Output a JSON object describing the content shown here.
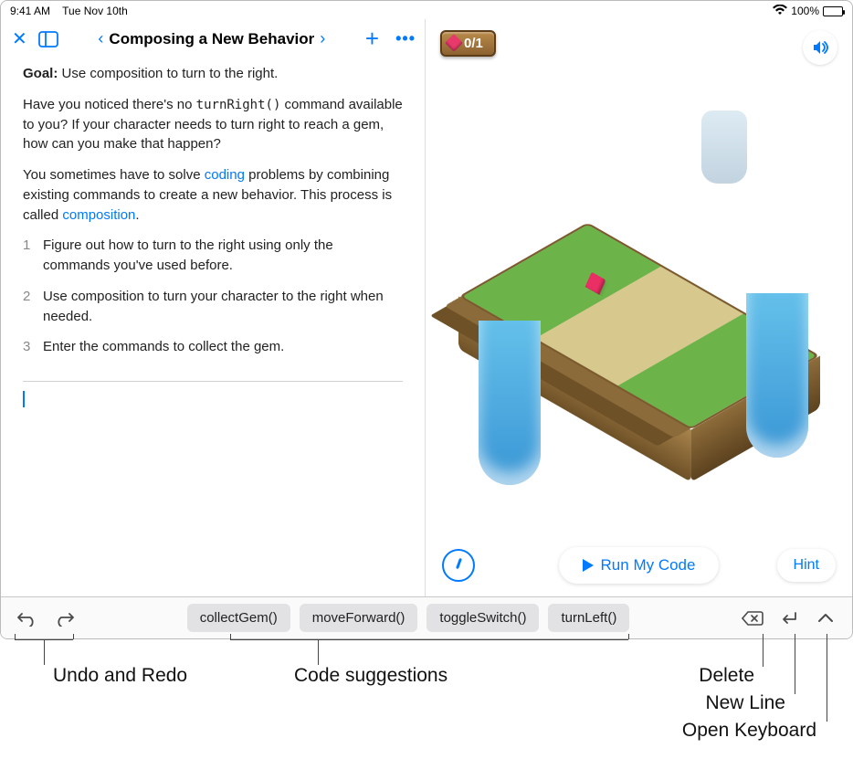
{
  "statusbar": {
    "time": "9:41 AM",
    "date": "Tue Nov 10th",
    "battery_pct": "100%"
  },
  "nav": {
    "title": "Composing a New Behavior"
  },
  "lesson": {
    "goal_label": "Goal:",
    "goal_text": "Use composition to turn to the right.",
    "para1_a": "Have you noticed there's no ",
    "para1_code": "turnRight()",
    "para1_b": " command available to you? If your character needs to turn right to reach a gem, how can you make that happen?",
    "para2_a": "You sometimes have to solve ",
    "para2_link1": "coding",
    "para2_b": " problems by combining existing commands to create a new behavior. This process is called ",
    "para2_link2": "composition",
    "para2_c": ".",
    "steps": [
      "Figure out how to turn to the right using only the commands you've used before.",
      "Use composition to turn your character to the right when needed.",
      "Enter the commands to collect the gem."
    ]
  },
  "scene": {
    "gem_counter": "0/1"
  },
  "runbar": {
    "run_label": "Run My Code",
    "hint_label": "Hint"
  },
  "toolbar": {
    "suggestions": [
      "collectGem()",
      "moveForward()",
      "toggleSwitch()",
      "turnLeft()"
    ]
  },
  "callouts": {
    "undo_redo": "Undo and Redo",
    "code_suggestions": "Code suggestions",
    "delete": "Delete",
    "new_line": "New Line",
    "open_keyboard": "Open Keyboard"
  }
}
